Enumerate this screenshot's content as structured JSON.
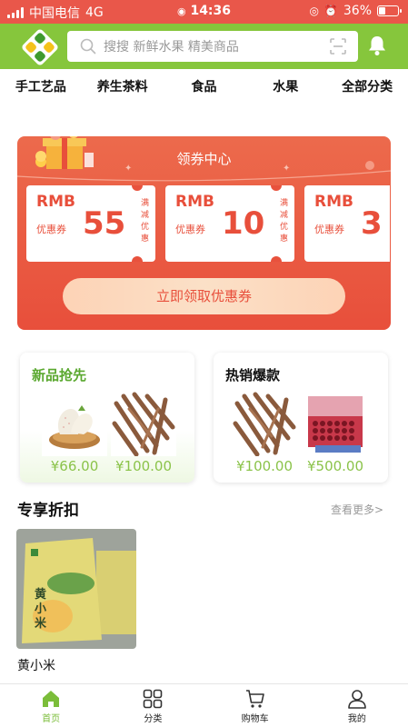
{
  "status_bar": {
    "carrier": "中国电信",
    "network": "4G",
    "time": "14:36",
    "battery": "36%",
    "battery_level": 0.36
  },
  "header": {
    "search_placeholder": "搜搜 新鲜水果 精美商品",
    "brand_color": "#86c63c"
  },
  "categories": [
    "手工艺品",
    "养生茶料",
    "食品",
    "水果",
    "全部分类"
  ],
  "coupon_center": {
    "title": "领券中心",
    "claim_button": "立即领取优惠券",
    "coupons": [
      {
        "currency": "RMB",
        "type": "优惠券",
        "amount": "55",
        "desc": "满减优惠"
      },
      {
        "currency": "RMB",
        "type": "优惠券",
        "amount": "10",
        "desc": "满减优惠"
      },
      {
        "currency": "RMB",
        "type": "优惠券",
        "amount": "3",
        "desc": ""
      }
    ],
    "accent_color": "#e84f3b"
  },
  "promos": [
    {
      "title": "新品抢先",
      "title_color": "#5aa82f",
      "items": [
        {
          "image": "strawberry-image",
          "price": "¥66.00"
        },
        {
          "image": "dried-root-image",
          "price": "¥100.00"
        }
      ]
    },
    {
      "title": "热销爆款",
      "title_color": "#111111",
      "items": [
        {
          "image": "dried-root-image",
          "price": "¥100.00"
        },
        {
          "image": "gift-box-image",
          "price": "¥500.00"
        }
      ]
    }
  ],
  "exclusive": {
    "title": "专享折扣",
    "more": "查看更多>",
    "product": {
      "name": "黄小米"
    }
  },
  "tabs": [
    {
      "label": "首页",
      "icon": "home-icon",
      "active": true
    },
    {
      "label": "分类",
      "icon": "grid-icon",
      "active": false
    },
    {
      "label": "购物车",
      "icon": "cart-icon",
      "active": false
    },
    {
      "label": "我的",
      "icon": "user-icon",
      "active": false
    }
  ]
}
